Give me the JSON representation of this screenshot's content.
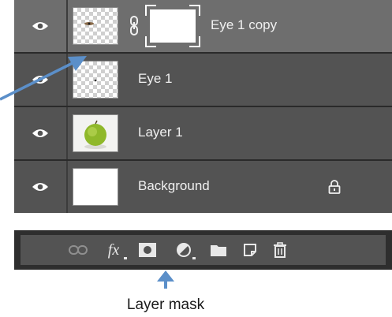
{
  "layers": [
    {
      "name": "Eye 1 copy",
      "selected": true,
      "has_mask": true,
      "thumb": "checker-eye"
    },
    {
      "name": "Eye 1",
      "selected": false,
      "has_mask": false,
      "thumb": "checker-dot"
    },
    {
      "name": "Layer 1",
      "selected": false,
      "has_mask": false,
      "thumb": "apple"
    },
    {
      "name": "Background",
      "selected": false,
      "has_mask": false,
      "thumb": "white",
      "locked": true
    }
  ],
  "toolbar": {
    "icons": [
      "link-icon",
      "fx-icon",
      "layer-mask-icon",
      "adjustment-icon",
      "folder-icon",
      "new-layer-icon",
      "trash-icon"
    ],
    "fx_label": "fx"
  },
  "annotation": {
    "caption": "Layer mask",
    "arrow_color": "#5b8fc9"
  },
  "colors": {
    "row_bg": "#535353",
    "row_selected_bg": "#6e6e6e",
    "panel_bg": "#2a2a2a"
  }
}
